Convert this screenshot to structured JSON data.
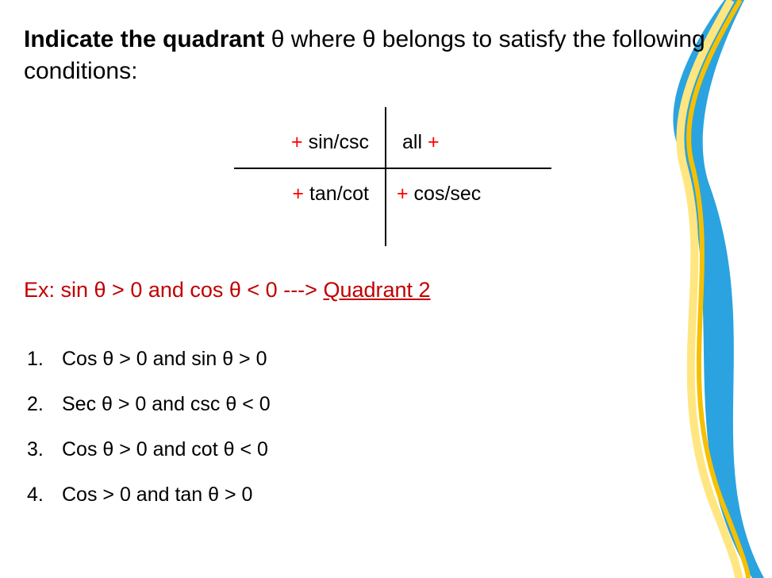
{
  "title": {
    "bold": "Indicate the quadrant",
    "rest": " θ where θ belongs to satisfy the following conditions:"
  },
  "quadrant_diagram": {
    "q2": {
      "sign": "+",
      "label": " sin/csc"
    },
    "q1": {
      "label": "all ",
      "sign": "+"
    },
    "q3": {
      "sign": "+",
      "label": " tan/cot"
    },
    "q4": {
      "sign": "+",
      "label": " cos/sec"
    }
  },
  "example": {
    "prefix": "Ex: sin θ > 0 and cos θ < 0  ---> ",
    "answer": "Quadrant 2"
  },
  "questions": [
    {
      "num": "1.",
      "text": "Cos θ > 0 and sin θ > 0"
    },
    {
      "num": "2.",
      "text": "Sec θ > 0 and csc θ < 0"
    },
    {
      "num": "3.",
      "text": "Cos θ > 0 and cot θ < 0"
    },
    {
      "num": "4.",
      "text": "Cos > 0 and tan θ > 0"
    }
  ]
}
